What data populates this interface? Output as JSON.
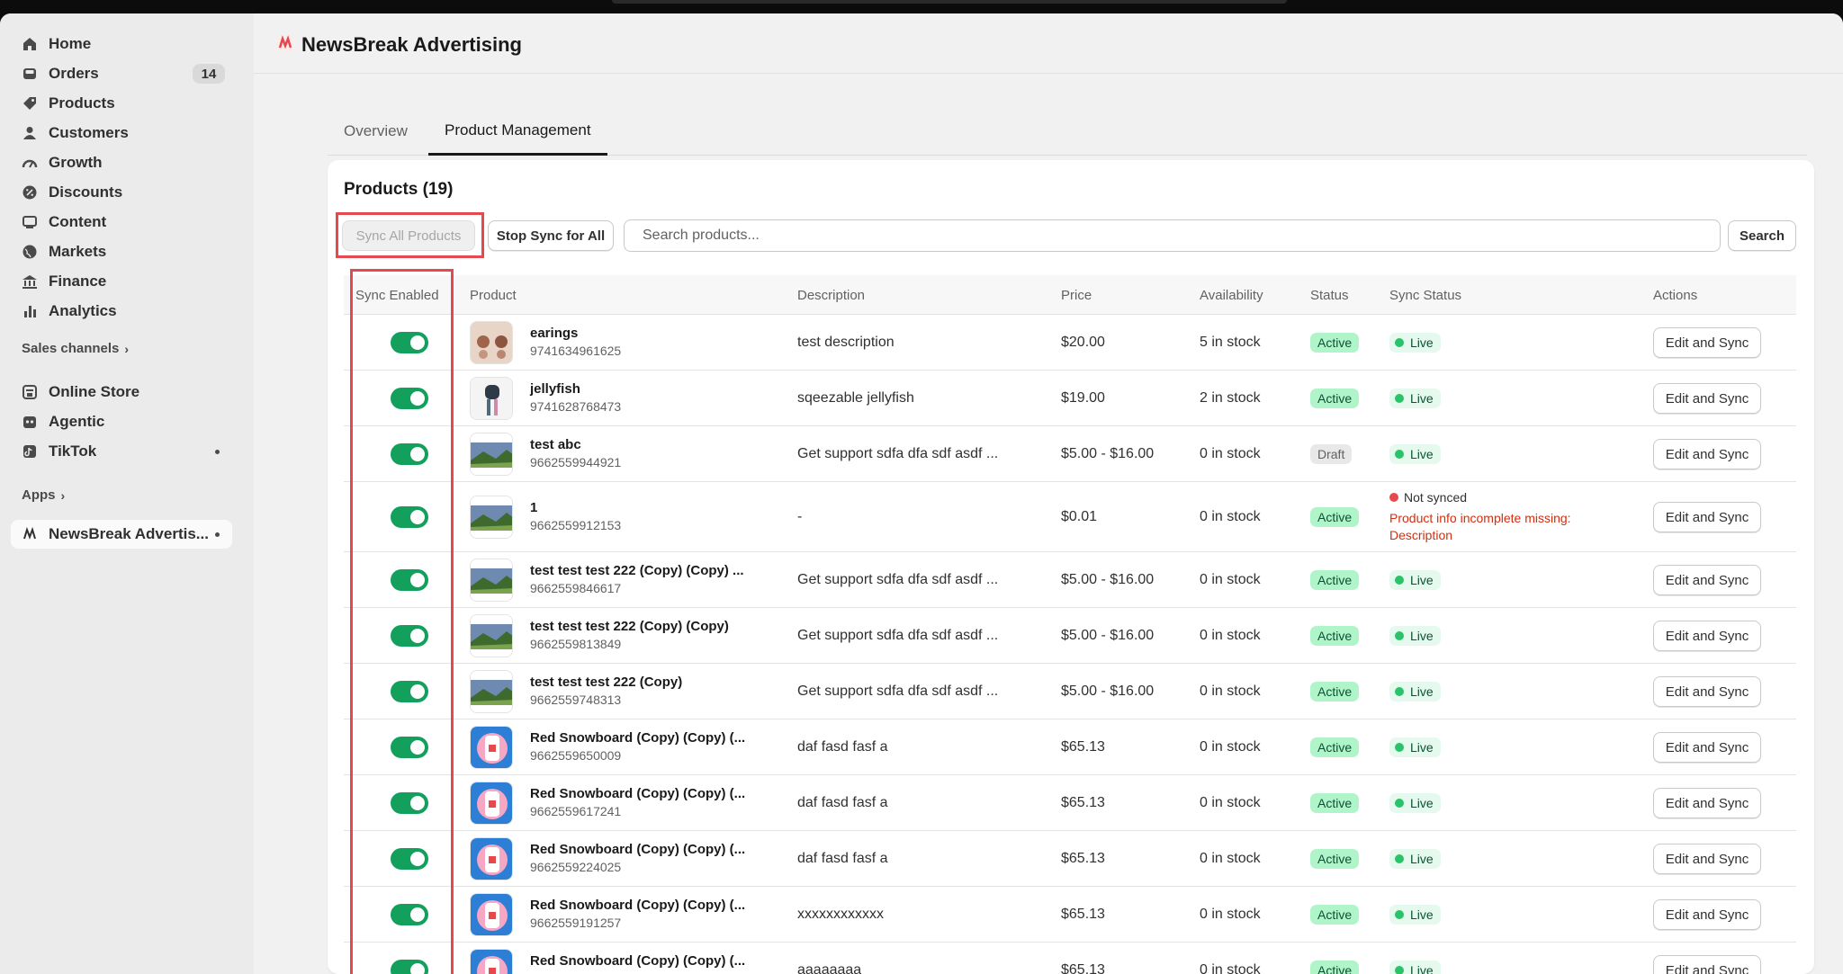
{
  "sidebar": {
    "items": [
      {
        "label": "Home",
        "icon": "home-icon"
      },
      {
        "label": "Orders",
        "icon": "inbox-icon",
        "badge": "14"
      },
      {
        "label": "Products",
        "icon": "tag-icon"
      },
      {
        "label": "Customers",
        "icon": "person-icon"
      },
      {
        "label": "Growth",
        "icon": "gauge-icon"
      },
      {
        "label": "Discounts",
        "icon": "discount-icon"
      },
      {
        "label": "Content",
        "icon": "content-icon"
      },
      {
        "label": "Markets",
        "icon": "globe-icon"
      },
      {
        "label": "Finance",
        "icon": "bank-icon"
      },
      {
        "label": "Analytics",
        "icon": "bar-chart-icon"
      }
    ],
    "sales_channels_label": "Sales channels",
    "channels": [
      {
        "label": "Online Store",
        "icon": "store-icon"
      },
      {
        "label": "Agentic",
        "icon": "robot-icon"
      },
      {
        "label": "TikTok",
        "icon": "tiktok-icon"
      }
    ],
    "apps_label": "Apps",
    "active_app": "NewsBreak Advertis..."
  },
  "header": {
    "title": "NewsBreak Advertising"
  },
  "tabs": [
    {
      "label": "Overview",
      "active": false
    },
    {
      "label": "Product Management",
      "active": true
    }
  ],
  "card": {
    "title": "Products (19)",
    "sync_all_label": "Sync All Products",
    "stop_sync_label": "Stop Sync for All",
    "search_placeholder": "Search products...",
    "search_button": "Search"
  },
  "table": {
    "columns": [
      "Sync Enabled",
      "Product",
      "Description",
      "Price",
      "Availability",
      "Status",
      "Sync Status",
      "Actions"
    ],
    "rows": [
      {
        "name": "earings",
        "id": "9741634961625",
        "desc": "test description",
        "price": "$20.00",
        "avail": "5 in stock",
        "status": "Active",
        "sync": "Live",
        "action": "Edit and Sync",
        "thumb": "earrings"
      },
      {
        "name": "jellyfish",
        "id": "9741628768473",
        "desc": "sqeezable jellyfish",
        "price": "$19.00",
        "avail": "2 in stock",
        "status": "Active",
        "sync": "Live",
        "action": "Edit and Sync",
        "thumb": "jellyfish"
      },
      {
        "name": "test abc",
        "id": "9662559944921",
        "desc": "Get support sdfa dfa sdf asdf ...",
        "price": "$5.00 - $16.00",
        "avail": "0 in stock",
        "status": "Draft",
        "sync": "Live",
        "action": "Edit and Sync",
        "thumb": "landscape"
      },
      {
        "name": "1",
        "id": "9662559912153",
        "desc": "-",
        "price": "$0.01",
        "avail": "0 in stock",
        "status": "Active",
        "sync": "Not synced",
        "sync_error": "Product info incomplete missing: Description",
        "action": "Edit and Sync",
        "thumb": "landscape"
      },
      {
        "name": "test test test 222 (Copy) (Copy) ...",
        "id": "9662559846617",
        "desc": "Get support sdfa dfa sdf asdf ...",
        "price": "$5.00 - $16.00",
        "avail": "0 in stock",
        "status": "Active",
        "sync": "Live",
        "action": "Edit and Sync",
        "thumb": "landscape"
      },
      {
        "name": "test test test 222 (Copy) (Copy)",
        "id": "9662559813849",
        "desc": "Get support sdfa dfa sdf asdf ...",
        "price": "$5.00 - $16.00",
        "avail": "0 in stock",
        "status": "Active",
        "sync": "Live",
        "action": "Edit and Sync",
        "thumb": "landscape"
      },
      {
        "name": "test test test 222 (Copy)",
        "id": "9662559748313",
        "desc": "Get support sdfa dfa sdf asdf ...",
        "price": "$5.00 - $16.00",
        "avail": "0 in stock",
        "status": "Active",
        "sync": "Live",
        "action": "Edit and Sync",
        "thumb": "landscape"
      },
      {
        "name": "Red Snowboard (Copy) (Copy) (...",
        "id": "9662559650009",
        "desc": "daf fasd fasf a",
        "price": "$65.13",
        "avail": "0 in stock",
        "status": "Active",
        "sync": "Live",
        "action": "Edit and Sync",
        "thumb": "snowboard"
      },
      {
        "name": "Red Snowboard (Copy) (Copy) (...",
        "id": "9662559617241",
        "desc": "daf fasd fasf a",
        "price": "$65.13",
        "avail": "0 in stock",
        "status": "Active",
        "sync": "Live",
        "action": "Edit and Sync",
        "thumb": "snowboard"
      },
      {
        "name": "Red Snowboard (Copy) (Copy) (...",
        "id": "9662559224025",
        "desc": "daf fasd fasf a",
        "price": "$65.13",
        "avail": "0 in stock",
        "status": "Active",
        "sync": "Live",
        "action": "Edit and Sync",
        "thumb": "snowboard"
      },
      {
        "name": "Red Snowboard (Copy) (Copy) (...",
        "id": "9662559191257",
        "desc": "xxxxxxxxxxxx",
        "price": "$65.13",
        "avail": "0 in stock",
        "status": "Active",
        "sync": "Live",
        "action": "Edit and Sync",
        "thumb": "snowboard"
      },
      {
        "name": "Red Snowboard (Copy) (Copy) (...",
        "id": "",
        "desc": "aaaaaaaa",
        "price": "$65.13",
        "avail": "0 in stock",
        "status": "Active",
        "sync": "Live",
        "action": "Edit and Sync",
        "thumb": "snowboard"
      }
    ]
  },
  "colors": {
    "accent_green": "#12a05c",
    "highlight_red": "#e5484d",
    "error_red": "#d72c0d"
  }
}
